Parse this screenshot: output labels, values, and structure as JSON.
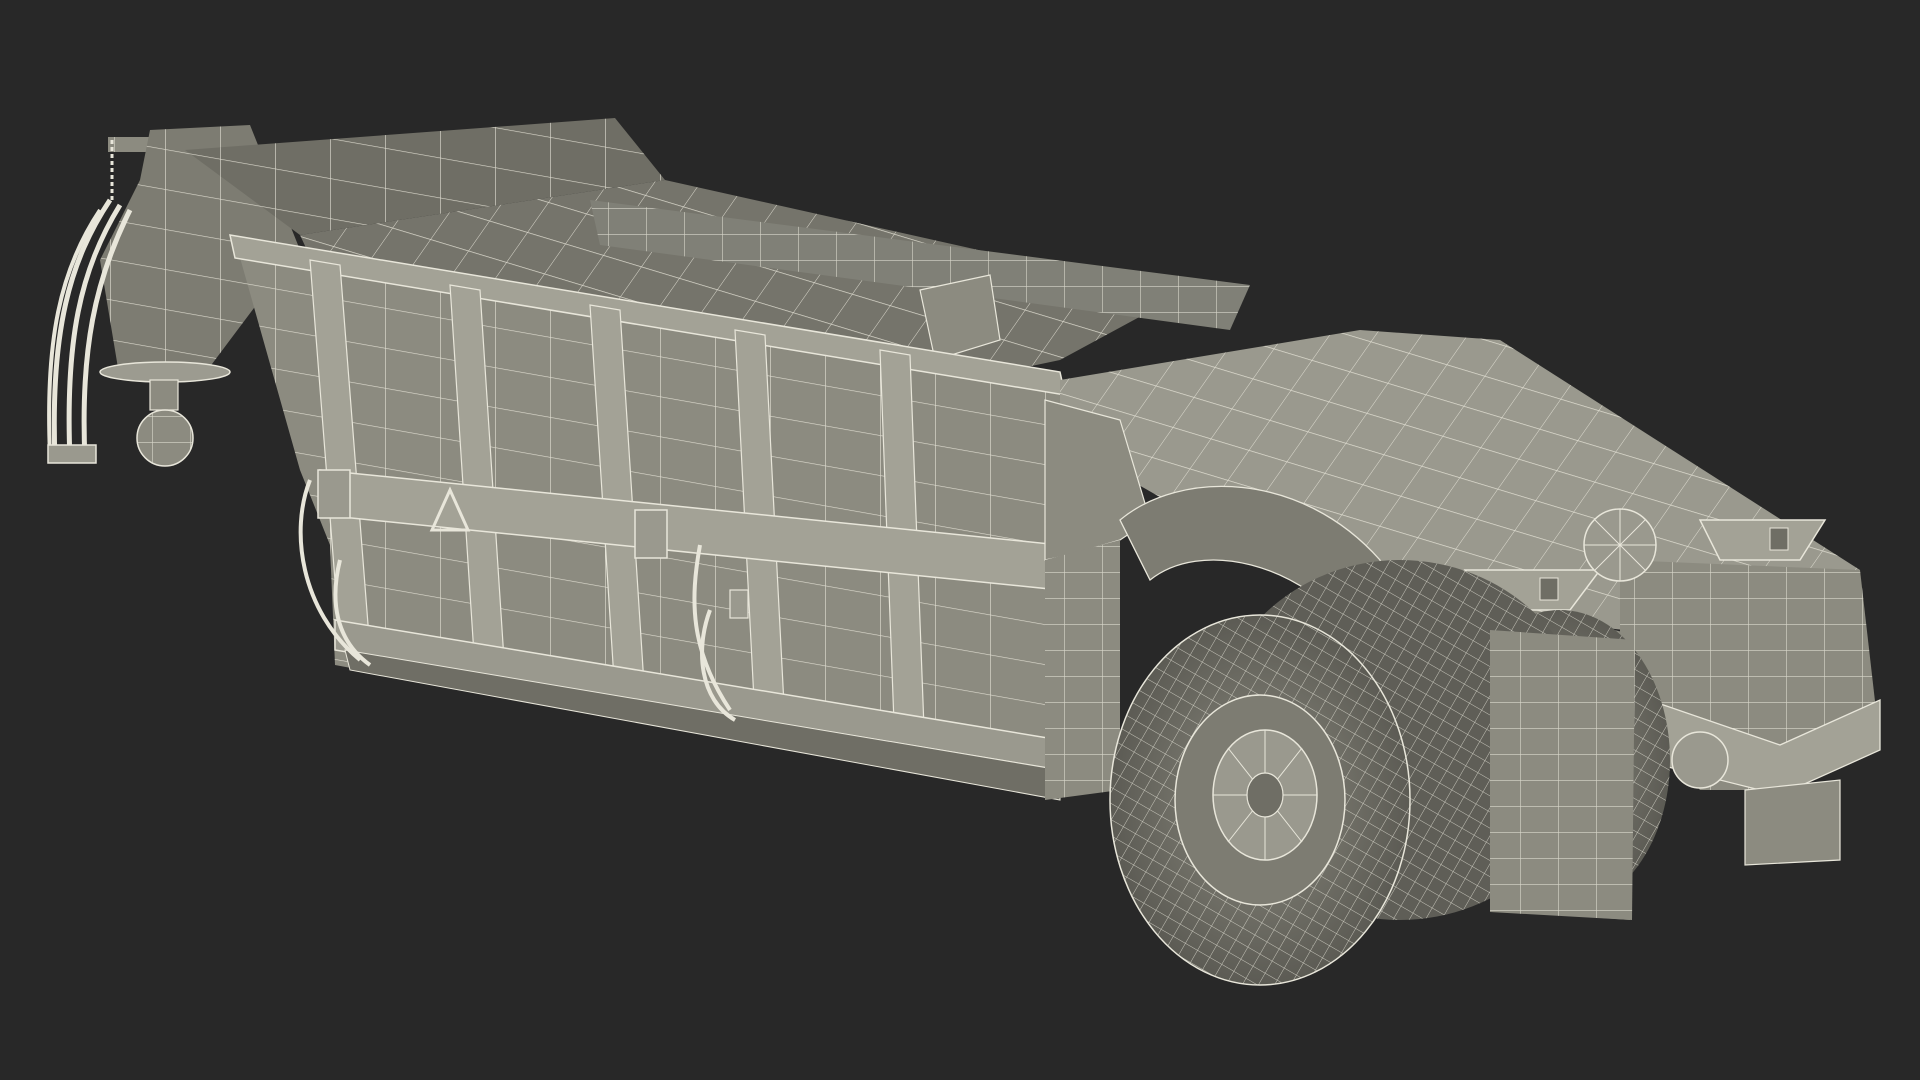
{
  "scene": {
    "subject": "wireframe-render",
    "colors": {
      "background": "#282828",
      "surface": "#8c8b80",
      "surface_dark": "#6f6e65",
      "surface_light": "#a3a296",
      "wire": "#e8e6da",
      "tire": "#75746b",
      "shadow": "#4f4e48"
    }
  }
}
